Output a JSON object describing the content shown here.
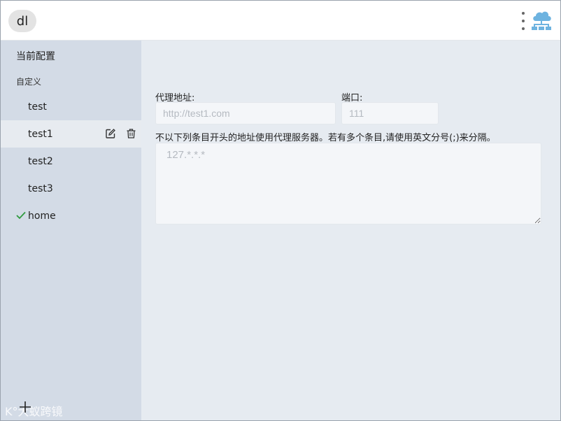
{
  "header": {
    "app_badge": "dl",
    "icons": [
      "more-vertical-icon",
      "cloud-network-icon"
    ],
    "accent_color": "#6db3e0"
  },
  "sidebar": {
    "current_label": "当前配置",
    "section_label": "自定义",
    "items": [
      {
        "label": "test"
      },
      {
        "label": "test1",
        "selected": true
      },
      {
        "label": "test2"
      },
      {
        "label": "test3"
      },
      {
        "label": "home",
        "active": true
      }
    ],
    "watermark": "K°大蚁跨镜"
  },
  "form": {
    "proxy_label": "代理地址:",
    "proxy_placeholder": "http://test1.com",
    "port_label": "端口:",
    "port_placeholder": "111",
    "bypass_label": "不以下列条目开头的地址使用代理服务器。若有多个条目,请使用英文分号(;)来分隔。",
    "bypass_placeholder": "127.*.*.*"
  }
}
